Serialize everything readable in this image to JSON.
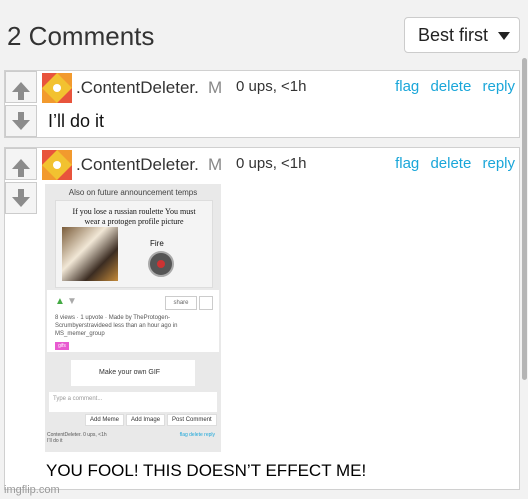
{
  "header": {
    "title": "2 Comments",
    "sort_label": "Best first"
  },
  "actions": {
    "flag": "flag",
    "delete": "delete",
    "reply": "reply"
  },
  "comments": [
    {
      "user": ".ContentDeleter.",
      "mod": "M",
      "meta": "0 ups, <1h",
      "text": "I’ll do it"
    },
    {
      "user": ".ContentDeleter.",
      "mod": "M",
      "meta": "0 ups, <1h",
      "text": "YOU FOOL! THIS DOESN’T EFFECT ME!"
    }
  ],
  "embed": {
    "title": "Also on future announcement temps",
    "caption": "If you lose a russian roulette You must wear a protogen profile picture",
    "fire": "Fire",
    "share": "share",
    "stats": "8 views · 1 upvote · Made by TheProtogen-Scrumbyerstravideed less than an hour ago in MS_memer_group",
    "tag": "gifs",
    "make_gif": "Make your own GIF",
    "comment_placeholder": "Type a comment...",
    "buttons": [
      "Add Meme",
      "Add Image",
      "Post Comment"
    ],
    "mini_user": "ContentDeleter.",
    "mini_meta": "0 ups, <1h",
    "mini_links": "flag delete reply",
    "mini_text": "I’ll do it"
  },
  "watermark": "imgflip.com",
  "colors": {
    "link": "#1aa6d9",
    "background": "#f2f2f2"
  }
}
